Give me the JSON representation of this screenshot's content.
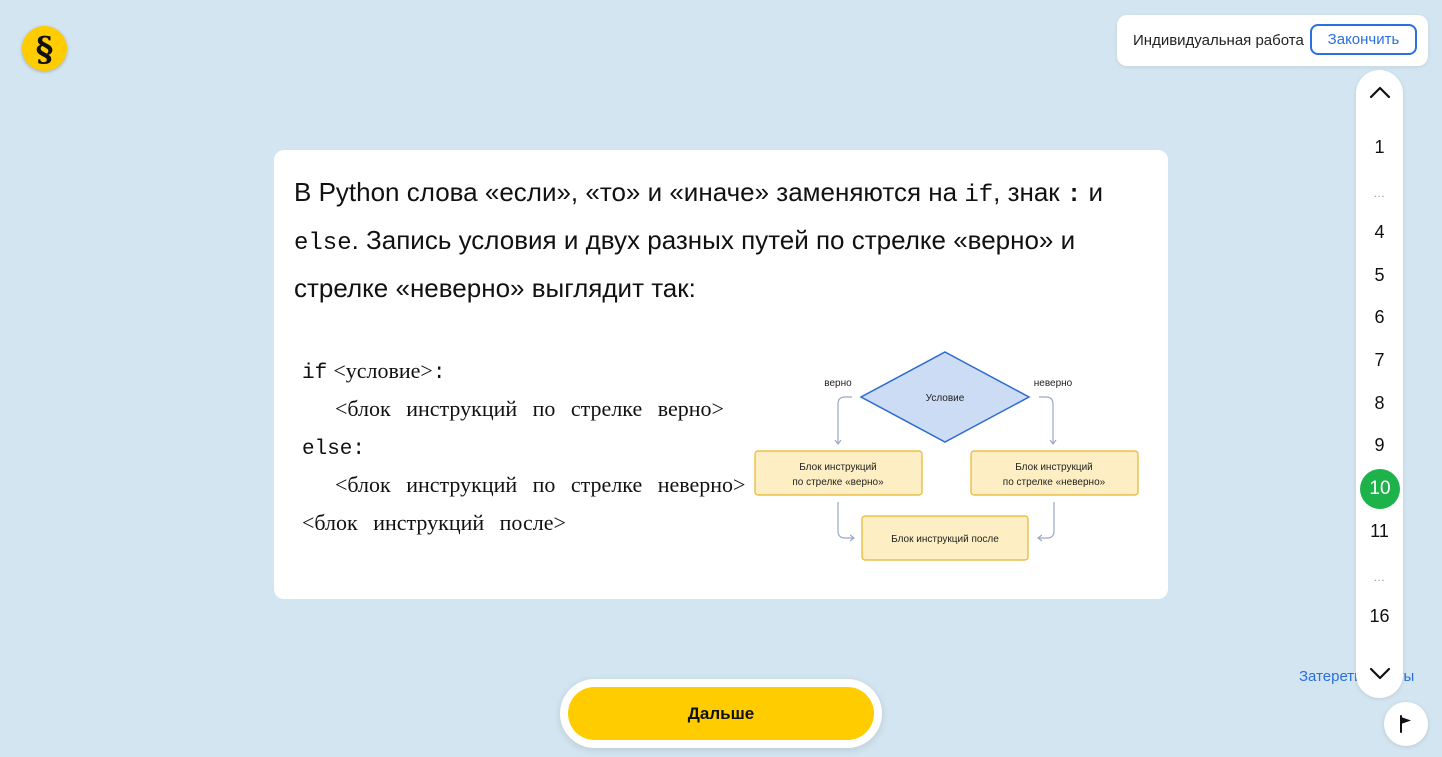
{
  "logo": {
    "glyph": "§"
  },
  "topbar": {
    "mode_label": "Индивидуальная работа",
    "finish_label": "Закончить"
  },
  "card": {
    "intro": {
      "t1": "В Python слова «если», «то» и «иначе» заменяются на ",
      "code_if": "if",
      "t2": ", знак ",
      "code_colon": ":",
      "t3": " и ",
      "code_else": "else",
      "t4": ". Запись условия и двух разных путей по стрелке «верно» и стрелке «неверно» выглядит так:"
    },
    "code": {
      "if_kw": "if",
      "cond": "<условие>",
      "colon": ":",
      "true_block": "<блок инструкций по стрелке верно>",
      "else_kw": "else:",
      "false_block": "<блок инструкций по стрелке неверно>",
      "after_block": "<блок инструкций после>"
    },
    "diagram": {
      "condition": "Условие",
      "true_label": "верно",
      "false_label": "неверно",
      "true_block_l1": "Блок инструкций",
      "true_block_l2": "по стрелке «верно»",
      "false_block_l1": "Блок инструкций",
      "false_block_l2": "по стрелке «неверно»",
      "after_block": "Блок инструкций после",
      "colors": {
        "diamond_fill": "#ccdcf4",
        "diamond_stroke": "#2e6bd0",
        "box_fill": "#fdefc3",
        "box_stroke": "#e8b528",
        "arrow": "#9aa9c8"
      }
    }
  },
  "sidenav": {
    "up_icon": "chevron-up-icon",
    "down_icon": "chevron-down-icon",
    "pages": [
      "1",
      "4",
      "5",
      "6",
      "7",
      "8",
      "9",
      "10",
      "11",
      "16"
    ],
    "dots": "…",
    "current_page": "10"
  },
  "erase_link": "Затереть ответы",
  "flag_icon": "flag-icon",
  "next_button": "Дальше",
  "colors": {
    "background": "#d3e5f0",
    "accent_yellow": "#ffcc00",
    "accent_blue": "#2b6fe0",
    "active_green": "#1db34a"
  }
}
